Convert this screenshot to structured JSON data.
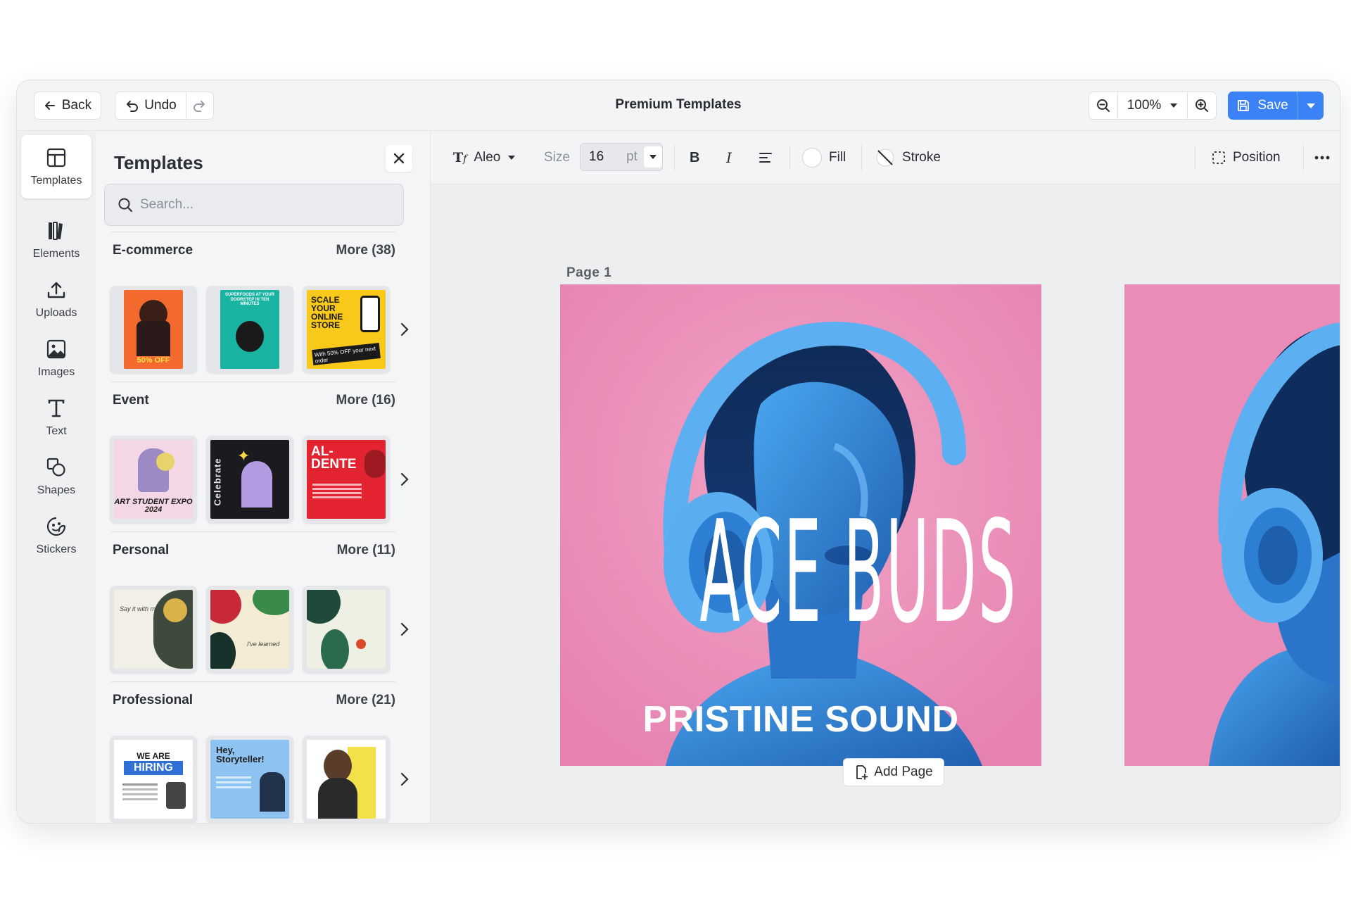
{
  "topbar": {
    "back_label": "Back",
    "undo_label": "Undo",
    "title": "Premium Templates",
    "zoom_value": "100%",
    "save_label": "Save"
  },
  "rail": {
    "items": [
      {
        "label": "Templates",
        "icon": "layout-icon",
        "active": true
      },
      {
        "label": "Elements",
        "icon": "elements-icon"
      },
      {
        "label": "Uploads",
        "icon": "upload-icon"
      },
      {
        "label": "Images",
        "icon": "image-icon"
      },
      {
        "label": "Text",
        "icon": "text-icon"
      },
      {
        "label": "Shapes",
        "icon": "shapes-icon"
      },
      {
        "label": "Stickers",
        "icon": "sticker-icon"
      }
    ]
  },
  "panel": {
    "title": "Templates",
    "search_placeholder": "Search...",
    "sections": [
      {
        "name": "E-commerce",
        "more": "More (38)"
      },
      {
        "name": "Event",
        "more": "More (16)"
      },
      {
        "name": "Personal",
        "more": "More (11)"
      },
      {
        "name": "Professional",
        "more": "More (21)"
      }
    ],
    "thumb_text": {
      "ecom1": "50% OFF",
      "ecom2": "SUPERFOODS AT YOUR DOORSTEP IN TEN MINUTES",
      "ecom3": "SCALE YOUR ONLINE STORE",
      "ecom3_sub": "With 50% OFF your next order",
      "event1": "ART STUDENT EXPO 2024",
      "event2": "Celebrate",
      "event3": "AL- DENTE",
      "pers1": "Say it with me",
      "pers2": "I've learned",
      "prof1_a": "WE ARE",
      "prof1_b": "HIRING",
      "prof2": "Hey, Storyteller!"
    }
  },
  "format_toolbar": {
    "font_name": "Aleo",
    "size_label": "Size",
    "size_value": "16",
    "size_unit": "pt",
    "fill_label": "Fill",
    "stroke_label": "Stroke",
    "position_label": "Position"
  },
  "canvas": {
    "page_label": "Page 1",
    "headline": "ACE BUDS",
    "subline": "PRISTINE SOUND",
    "add_page_label": "Add Page"
  },
  "colors": {
    "accent": "#3b82f6",
    "page_background": "#e98db8",
    "portrait_blue": "#2f7fd1"
  }
}
